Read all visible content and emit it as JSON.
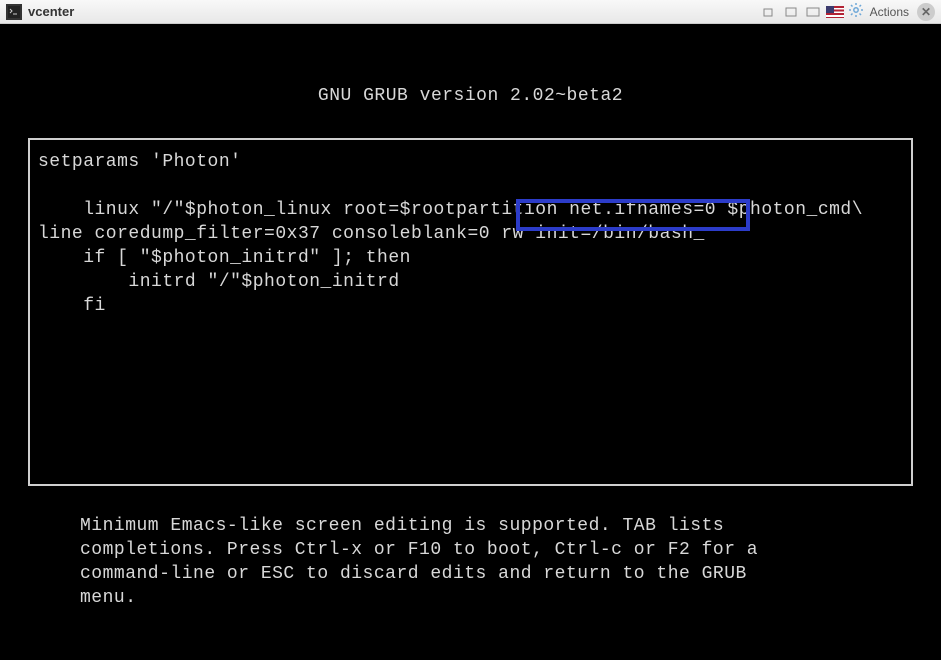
{
  "window": {
    "title": "vcenter",
    "actions_label": "Actions"
  },
  "grub": {
    "header": "GNU GRUB  version 2.02~beta2",
    "editor": {
      "line1": "setparams 'Photon'",
      "line2": "",
      "line3": "    linux \"/\"$photon_linux root=$rootpartition net.ifnames=0 $photon_cmd\\",
      "line4pre": "line coredump_filter=0x37 consoleblank=0 ",
      "line4hl": "rw init=/bin/bash",
      "cursor": "_",
      "line5": "    if [ \"$photon_initrd\" ]; then",
      "line6": "        initrd \"/\"$photon_initrd",
      "line7": "    fi"
    },
    "footer": "Minimum Emacs-like screen editing is supported. TAB lists\ncompletions. Press Ctrl-x or F10 to boot, Ctrl-c or F2 for a\ncommand-line or ESC to discard edits and return to the GRUB\nmenu."
  }
}
